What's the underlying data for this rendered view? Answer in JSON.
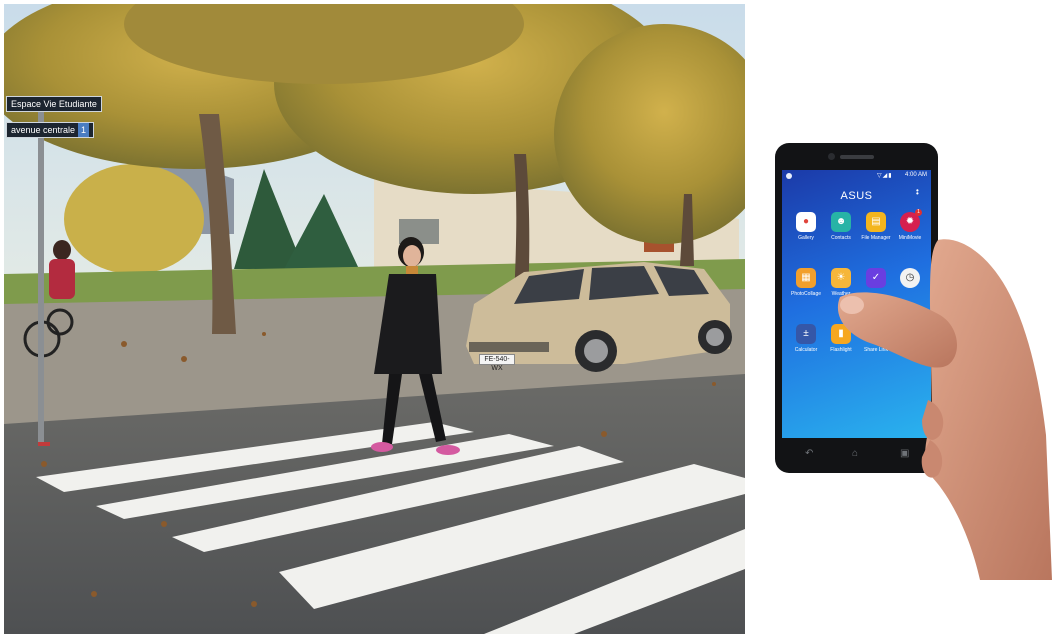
{
  "street_scene": {
    "sign_top": "Espace Vie Etudiante",
    "sign_bottom": "avenue centrale",
    "sign_number": "1",
    "plate": "FE-540-WX"
  },
  "phone": {
    "status_time": "4:00 AM",
    "brand": "ASUS",
    "apps": [
      {
        "label": "Gallery",
        "icon": "gallery-icon",
        "color": "#ffffff"
      },
      {
        "label": "Contacts",
        "icon": "contacts-icon",
        "color": "#27b3a6"
      },
      {
        "label": "File Manager",
        "icon": "folder-icon",
        "color": "#f3b51e"
      },
      {
        "label": "MiniMovie",
        "icon": "film-reel-icon",
        "color": "#d6204f",
        "badge": "1"
      },
      {
        "label": "PhotoCollage",
        "icon": "collage-icon",
        "color": "#f29f2c"
      },
      {
        "label": "Weather",
        "icon": "weather-icon",
        "color": "#f6b63a"
      },
      {
        "label": "",
        "icon": "checkmark-icon",
        "color": "#6a3ee0"
      },
      {
        "label": "",
        "icon": "clock-icon",
        "color": "#f2f2f2"
      },
      {
        "label": "Calculator",
        "icon": "calculator-icon",
        "color": "#3557a8"
      },
      {
        "label": "Flashlight",
        "icon": "flashlight-icon",
        "color": "#f6a720"
      },
      {
        "label": "Share Link",
        "icon": "share-link-icon",
        "color": "#27b24a"
      }
    ],
    "nav": {
      "back_icon": "back-icon",
      "home_icon": "home-icon",
      "recent_icon": "recent-apps-icon"
    }
  },
  "colors": {
    "asphalt": "#57595a",
    "crosswalk": "#f1f1ee",
    "foliage": "#b39a3c",
    "car": "#cdbc9a",
    "phone_body": "#121315",
    "skin": "#d79b82"
  }
}
